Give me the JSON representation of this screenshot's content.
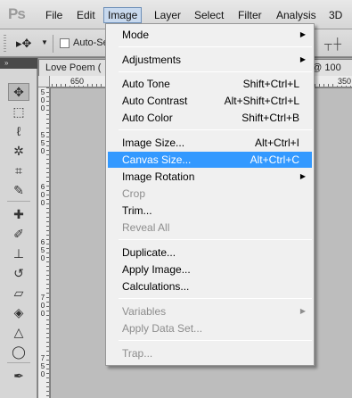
{
  "app": {
    "logo": "Ps"
  },
  "menubar": {
    "items": [
      "File",
      "Edit",
      "Image",
      "Layer",
      "Select",
      "Filter",
      "Analysis",
      "3D"
    ],
    "active": "Image"
  },
  "options": {
    "tool_icon": "move-tool-icon",
    "auto_select_label": "Auto-Se"
  },
  "document": {
    "tab_title": "Love Poem (",
    "tab_right": "g @ 100",
    "ruler_top": [
      "650",
      "350"
    ],
    "ruler_left": [
      "5",
      "0",
      "0",
      "5",
      "5",
      "0",
      "6",
      "0",
      "0",
      "6",
      "5",
      "0",
      "7",
      "0",
      "0",
      "7",
      "5",
      "0"
    ]
  },
  "tools": [
    "move-tool-icon",
    "marquee-tool-icon",
    "lasso-tool-icon",
    "quick-select-icon",
    "crop-tool-icon",
    "eyedropper-icon",
    "healing-brush-icon",
    "brush-tool-icon",
    "clone-stamp-icon",
    "history-brush-icon",
    "eraser-icon",
    "paint-bucket-icon",
    "blur-tool-icon",
    "dodge-tool-icon",
    "pen-tool-icon"
  ],
  "image_menu": {
    "groups": [
      [
        {
          "label": "Mode",
          "submenu": true
        }
      ],
      [
        {
          "label": "Adjustments",
          "submenu": true
        }
      ],
      [
        {
          "label": "Auto Tone",
          "shortcut": "Shift+Ctrl+L"
        },
        {
          "label": "Auto Contrast",
          "shortcut": "Alt+Shift+Ctrl+L"
        },
        {
          "label": "Auto Color",
          "shortcut": "Shift+Ctrl+B"
        }
      ],
      [
        {
          "label": "Image Size...",
          "shortcut": "Alt+Ctrl+I"
        },
        {
          "label": "Canvas Size...",
          "shortcut": "Alt+Ctrl+C",
          "highlighted": true
        },
        {
          "label": "Image Rotation",
          "submenu": true
        },
        {
          "label": "Crop",
          "disabled": true
        },
        {
          "label": "Trim..."
        },
        {
          "label": "Reveal All",
          "disabled": true
        }
      ],
      [
        {
          "label": "Duplicate..."
        },
        {
          "label": "Apply Image..."
        },
        {
          "label": "Calculations..."
        }
      ],
      [
        {
          "label": "Variables",
          "submenu": true,
          "disabled": true
        },
        {
          "label": "Apply Data Set...",
          "disabled": true
        }
      ],
      [
        {
          "label": "Trap...",
          "disabled": true
        }
      ]
    ]
  },
  "colors": {
    "highlight": "#3399ff",
    "disabled": "#8d8d8d",
    "menu_bg": "#f0f0f0"
  }
}
